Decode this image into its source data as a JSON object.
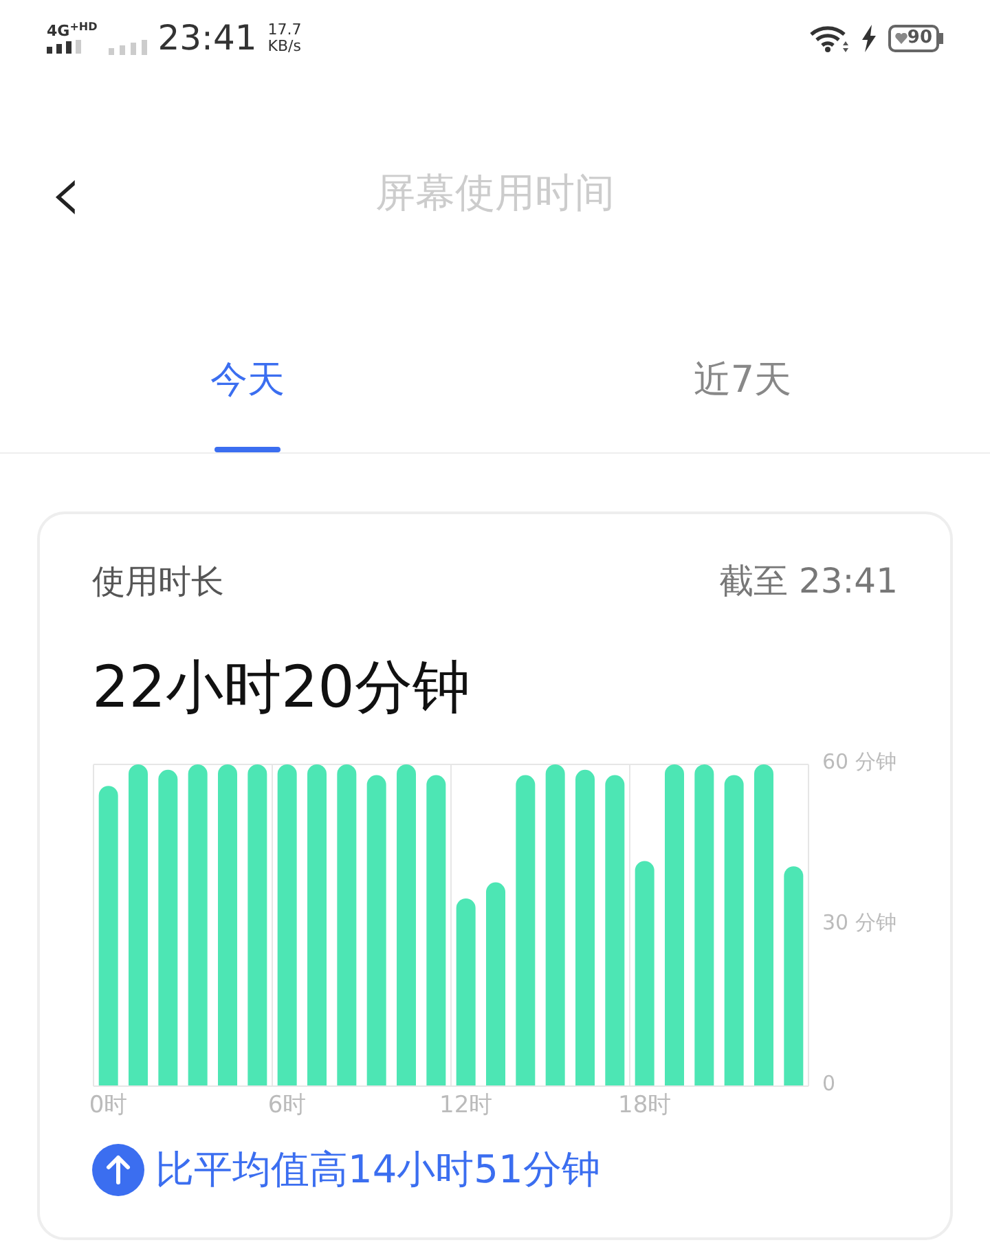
{
  "status_bar": {
    "network": "4G",
    "network_sup": "+HD",
    "time": "23:41",
    "speed": "17.7",
    "speed_unit": "KB/s",
    "battery": "90"
  },
  "header": {
    "back": "‹",
    "title": "屏幕使用时间"
  },
  "tabs": [
    {
      "label": "今天",
      "selected": true
    },
    {
      "label": "近7天",
      "selected": false
    }
  ],
  "card": {
    "label": "使用时长",
    "as_of": "截至 23:41",
    "total": "22小时20分钟",
    "chart_data": {
      "type": "bar",
      "x": [
        0,
        1,
        2,
        3,
        4,
        5,
        6,
        7,
        8,
        9,
        10,
        11,
        12,
        13,
        14,
        15,
        16,
        17,
        18,
        19,
        20,
        21,
        22,
        23
      ],
      "xlim": [
        -0.5,
        23.5
      ],
      "series": [
        {
          "color": "#4de6b4",
          "values": [
            56,
            60,
            59,
            60,
            60,
            60,
            60,
            60,
            60,
            58,
            60,
            58,
            35,
            38,
            58,
            60,
            59,
            58,
            42,
            60,
            60,
            58,
            60,
            41
          ]
        }
      ],
      "ylim": [
        0,
        60
      ],
      "yticks": [
        {
          "value": 0,
          "label": "0"
        },
        {
          "value": 30,
          "label": "30 分钟"
        },
        {
          "value": 60,
          "label": "60 分钟"
        }
      ],
      "xticks": [
        {
          "value": 0,
          "label": "0时"
        },
        {
          "value": 6,
          "label": "6时"
        },
        {
          "value": 12,
          "label": "12时"
        },
        {
          "value": 18,
          "label": "18时"
        }
      ]
    },
    "comparison": "比平均值高14小时51分钟"
  }
}
